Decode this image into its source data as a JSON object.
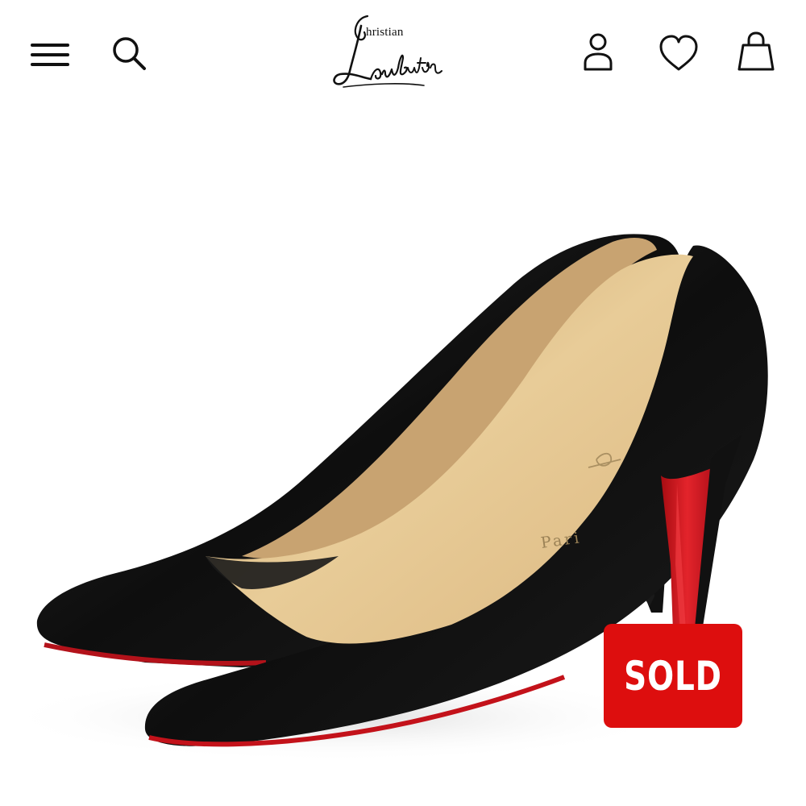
{
  "header": {
    "logo": {
      "top_text": "hristian",
      "script_text": "Louboutin"
    },
    "icons": {
      "menu": "hamburger-menu-icon",
      "search": "search-icon",
      "account": "account-icon",
      "wishlist": "heart-icon",
      "bag": "shopping-bag-icon"
    }
  },
  "product": {
    "insole_stamp": "Pari",
    "sole_color": "#d7141a",
    "upper_color": "#111111",
    "lining_color": "#e3c38e"
  },
  "badge": {
    "label": "SOLD",
    "color": "#dd0e0e"
  }
}
